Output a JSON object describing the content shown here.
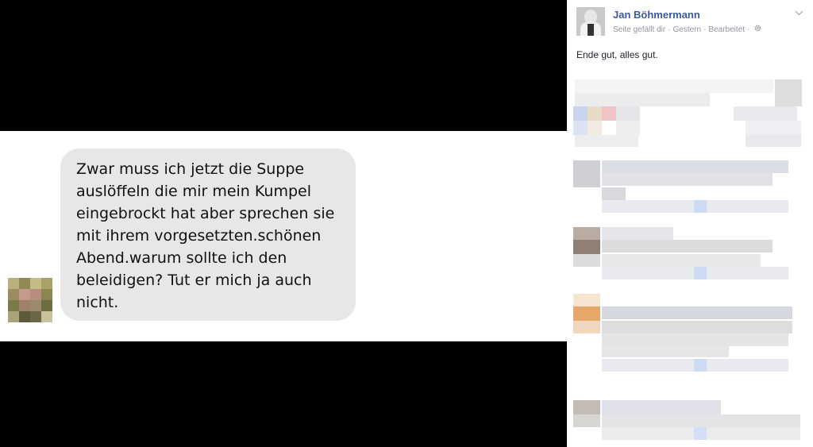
{
  "chat": {
    "message": "Zwar muss ich jetzt die Suppe\nauslöffeln die mir mein Kumpel\neingebrockt hat  aber sprechen sie\nmit ihrem vorgesetzten.schönen\nAbend.warum sollte ich den\nbeleidigen? Tut er mich ja auch\nnicht."
  },
  "post": {
    "author": "Jan Böhmermann",
    "meta": [
      "Seite gefällt dir",
      "Gestern",
      "Bearbeitet"
    ],
    "text": "Ende gut, alles gut."
  },
  "colors": {
    "bubble": "#e9e6e8",
    "author_link": "#3b5998",
    "meta_text": "#90949c"
  },
  "icons": [
    "gear-icon",
    "chevron-down-icon"
  ]
}
